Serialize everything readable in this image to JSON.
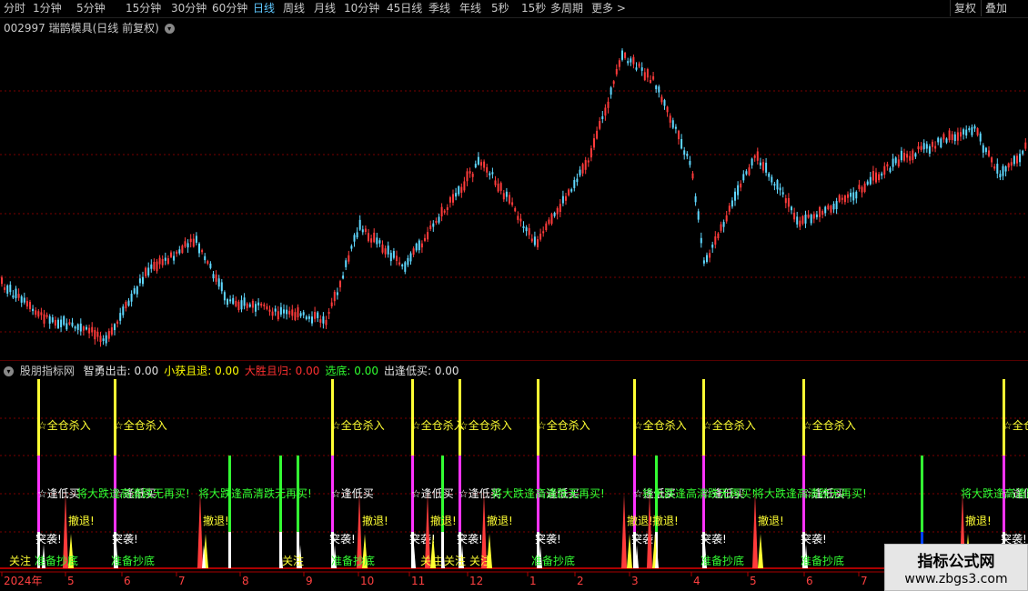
{
  "toolbar": {
    "periods": [
      "分时",
      "1分钟",
      "5分钟",
      "15分钟",
      "30分钟",
      "60分钟",
      "日线",
      "周线",
      "月线",
      "10分钟",
      "45日线",
      "季线",
      "年线",
      "5秒",
      "15秒",
      "多周期",
      "更多 >"
    ],
    "active_period": "日线",
    "buttons": [
      "复权",
      "叠加"
    ]
  },
  "price_panel": {
    "title": "002997 瑞鹊模具(日线 前复权)"
  },
  "indicator": {
    "name": "股朋指标网",
    "values": [
      {
        "label": "智勇出击:",
        "value": "0.00",
        "color": "#e0e0e0"
      },
      {
        "label": "小获且退:",
        "value": "0.00",
        "color": "#ffff00"
      },
      {
        "label": "大胜且归:",
        "value": "0.00",
        "color": "#ff3030"
      },
      {
        "label": "选底:",
        "value": "0.00",
        "color": "#30ff30"
      },
      {
        "label": "出逢低买:",
        "value": "0.00",
        "color": "#e0e0e0"
      }
    ],
    "signals": {
      "quan_cang": "☆全仓杀入",
      "feng_di": "☆逢低买",
      "da_die": "将大跌逢高清跌无再买!",
      "che_tui": "撤退!",
      "tu_po": "突袭!",
      "zhun_bei": "准备抄底",
      "guan_zhu": "关注"
    }
  },
  "time_axis": {
    "labels": [
      "2024年",
      "5",
      "6",
      "7",
      "8",
      "9",
      "10",
      "11",
      "12",
      "1",
      "2",
      "3",
      "4",
      "5",
      "6",
      "7"
    ]
  },
  "watermark": {
    "title": "指标公式网",
    "url": "www.zbgs3.com"
  },
  "colors": {
    "up": "#ff3b3b",
    "down": "#5fd8ff",
    "grid": "#7a0000",
    "signal_yellow": "#ffff33",
    "signal_magenta": "#ff33ff",
    "signal_green": "#33ff33",
    "signal_white": "#ffffff"
  }
}
